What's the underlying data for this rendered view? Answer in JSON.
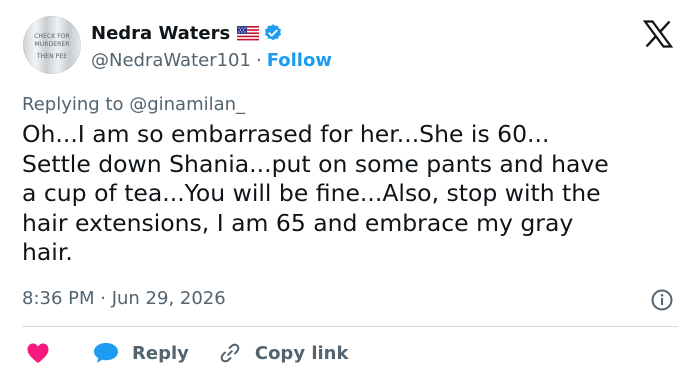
{
  "author": {
    "name": "Nedra Waters",
    "handle": "@NedraWater101",
    "separator": "·",
    "follow_label": "Follow",
    "avatar_text": [
      "CHECK FOR",
      "MURDERER",
      "THEN PEE"
    ]
  },
  "tweet": {
    "replying_prefix": "Replying to ",
    "replying_user": "@ginamilan_",
    "text": "Oh...I am so embarrased for her...She is 60...\nSettle down Shania...put on some pants and have\na cup of tea...You will be fine...Also, stop with the\nhair extensions, I am 65 and embrace my gray\nhair.",
    "timestamp": "8:36 PM · Jun 29, 2026"
  },
  "actions": {
    "reply_label": "Reply",
    "copy_link_label": "Copy link"
  },
  "icons": {
    "brand": "x-logo-icon",
    "verified": "verified-badge-icon",
    "flag": "us-flag-icon",
    "info": "info-icon",
    "like": "heart-icon",
    "reply": "speech-bubble-icon",
    "copy": "link-icon"
  },
  "colors": {
    "accent": "#1d9bf0",
    "like": "#f91880",
    "text": "#0f1419",
    "secondary_text": "#536471",
    "divider": "#cfd9de"
  }
}
